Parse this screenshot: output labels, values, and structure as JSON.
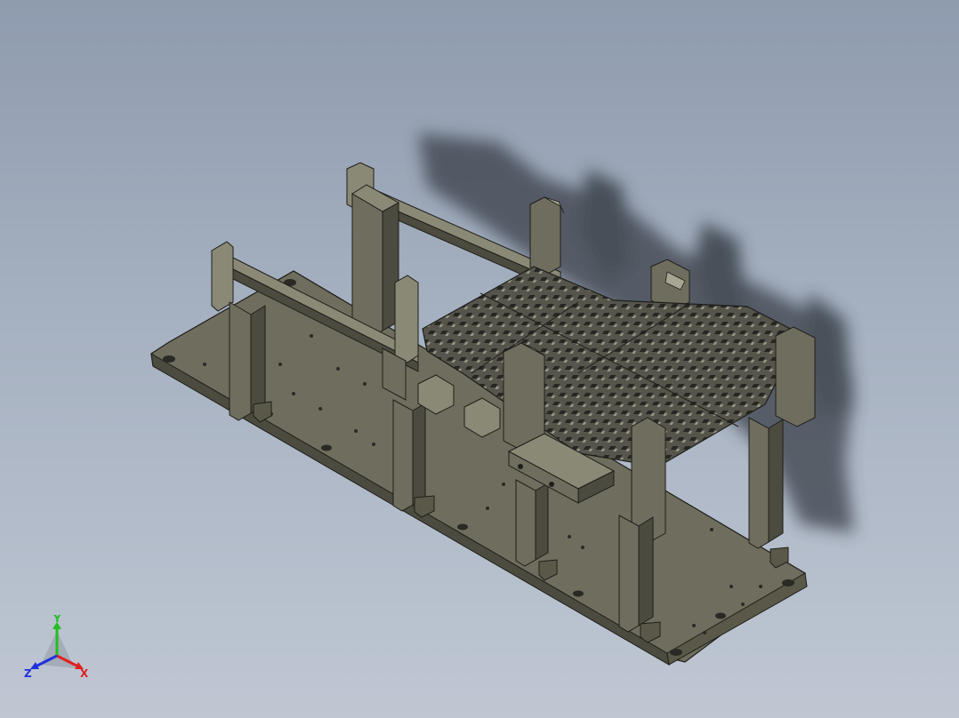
{
  "viewport": {
    "background_top": "#8f9bae",
    "background_bottom": "#bfc7d3"
  },
  "model": {
    "part_color": "#6f6e5e",
    "part_light": "#8a8976",
    "part_dark": "#4c4b3f",
    "edge_color": "#1e1e1a",
    "tray_color": "#3f3f3a",
    "shadow_color": "#3a3f48"
  },
  "triad": {
    "x_label": "X",
    "y_label": "Y",
    "z_label": "Z",
    "x_color": "#e02020",
    "y_color": "#20c020",
    "z_color": "#2030e0"
  }
}
